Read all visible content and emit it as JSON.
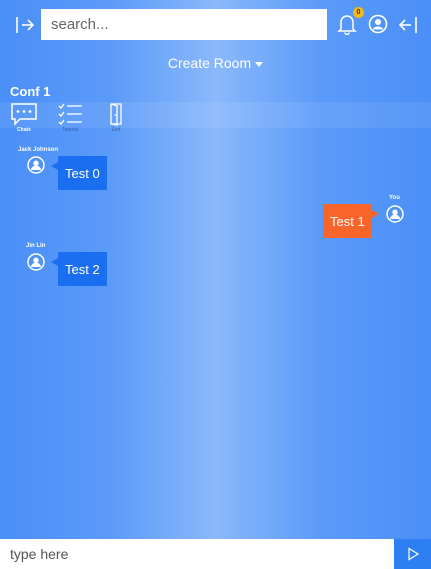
{
  "search": {
    "placeholder": "search..."
  },
  "notifications": {
    "count": "0"
  },
  "create_room": {
    "label": "Create Room"
  },
  "room": {
    "title": "Conf 1"
  },
  "tabs": [
    {
      "label": "Chats",
      "icon": "chat-bubble-icon"
    },
    {
      "label": "Tutorial",
      "icon": "checklist-icon"
    },
    {
      "label": "Exit",
      "icon": "door-icon"
    }
  ],
  "messages": [
    {
      "sender": "Jack Johnson",
      "text": "Test 0",
      "direction": "incoming"
    },
    {
      "sender": "You",
      "text": "Test 1",
      "direction": "outgoing"
    },
    {
      "sender": "Jin Lin",
      "text": "Test 2",
      "direction": "incoming"
    }
  ],
  "composer": {
    "placeholder": "type here"
  },
  "colors": {
    "incoming": "#1a6ef0",
    "outgoing": "#f7652b",
    "badge": "#f5b914",
    "send": "#2f7ff4"
  }
}
